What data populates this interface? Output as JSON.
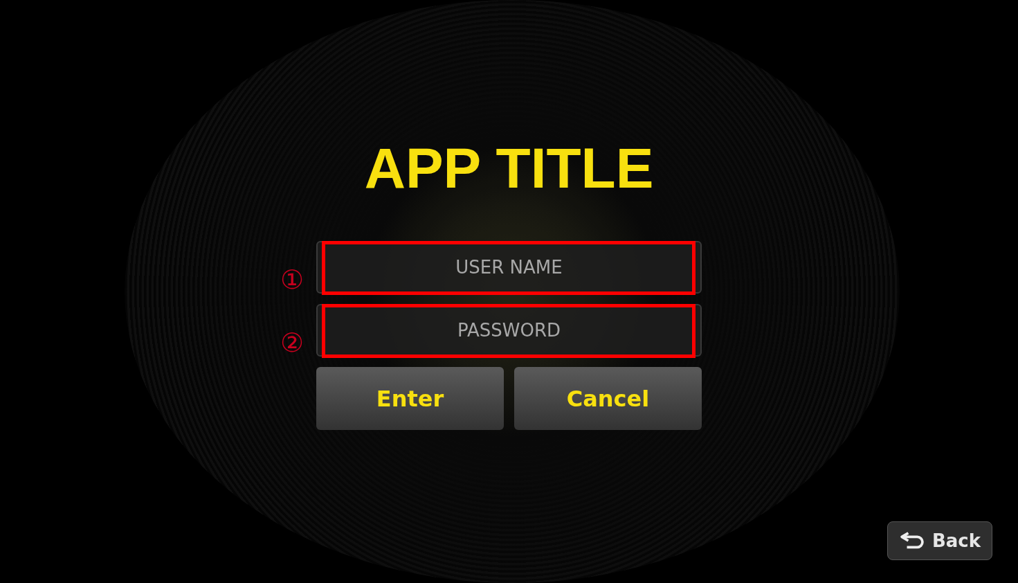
{
  "app_title": "APP TITLE",
  "fields": [
    {
      "placeholder": "USER NAME",
      "annotation": "①"
    },
    {
      "placeholder": "PASSWORD",
      "annotation": "②"
    }
  ],
  "buttons": [
    {
      "label": "Enter"
    },
    {
      "label": "Cancel"
    }
  ],
  "back_button": {
    "label": "Back"
  }
}
